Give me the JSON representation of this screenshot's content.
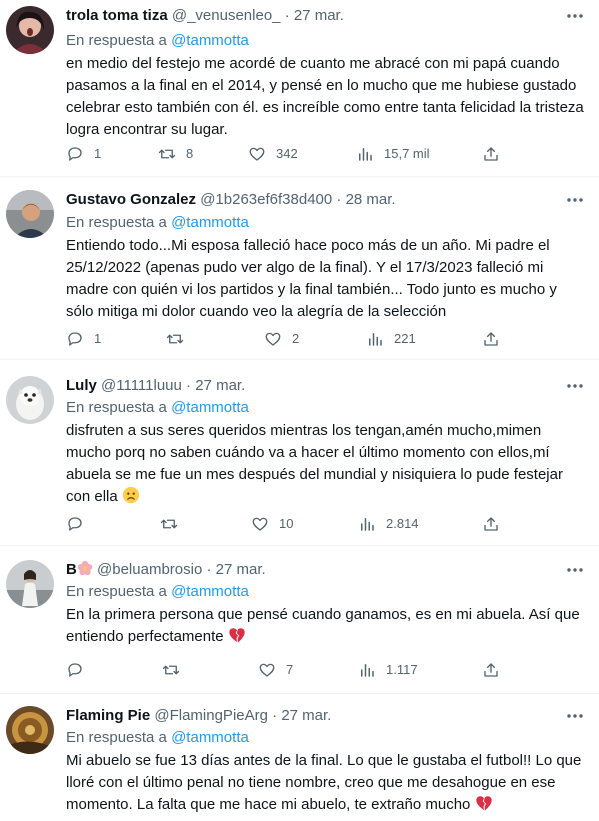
{
  "tweets": [
    {
      "name": "trola toma tiza",
      "handle": "@_venusenleo_",
      "separator": "·",
      "date": "27 mar.",
      "reply_prefix": "En respuesta a",
      "reply_to": "@tammotta",
      "text": "en medio del festejo me acordé de cuanto me abracé con mi papá cuando pasamos a la final en el 2014, y pensé en lo mucho que me hubiese gustado celebrar esto también con él. es increíble como entre tanta felicidad la tristeza logra encontrar su lugar.",
      "replies": "1",
      "retweets": "8",
      "likes": "342",
      "views": "15,7 mil"
    },
    {
      "name": "Gustavo Gonzalez",
      "handle": "@1b263ef6f38d400",
      "separator": "·",
      "date": "28 mar.",
      "reply_prefix": "En respuesta a",
      "reply_to": "@tammotta",
      "text": "Entiendo todo...Mi esposa falleció hace poco más de un año. Mi padre el 25/12/2022 (apenas pudo ver algo de la final). Y el 17/3/2023 falleció mi madre con quién vi los partidos y la final también... Todo junto es mucho y sólo mitiga mi dolor cuando veo la alegría de la selección",
      "replies": "1",
      "retweets": "",
      "likes": "2",
      "views": "221"
    },
    {
      "name": "Luly",
      "handle": "@11111luuu",
      "separator": "·",
      "date": "27 mar.",
      "reply_prefix": "En respuesta a",
      "reply_to": "@tammotta",
      "text": "disfruten a sus seres queridos mientras los tengan,amén mucho,mimen mucho porq no saben cuándo va a hacer el último momento con ellos,mí abuela se me fue un mes después del mundial y nisiquiera lo pude festejar con ella",
      "emoji": "🙁",
      "replies": "",
      "retweets": "",
      "likes": "10",
      "views": "2.814"
    },
    {
      "name": "B",
      "name_emoji": "🌸",
      "handle": "@beluambrosio",
      "separator": "·",
      "date": "27 mar.",
      "reply_prefix": "En respuesta a",
      "reply_to": "@tammotta",
      "text": "En la primera persona que pensé cuando ganamos, es en mi abuela. Así que entiendo perfectamente",
      "emoji": "💔",
      "replies": "",
      "retweets": "",
      "likes": "7",
      "views": "1.117"
    },
    {
      "name": "Flaming Pie",
      "handle": "@FlamingPieArg",
      "separator": "·",
      "date": "27 mar.",
      "reply_prefix": "En respuesta a",
      "reply_to": "@tammotta",
      "text": "Mi abuelo se fue 13 días antes de la final. Lo que le gustaba el futbol!! Lo que lloré con el último penal no tiene nombre, creo que me desahogue en ese momento. La falta que me hace mi abuelo, te extraño mucho",
      "emoji": "💔",
      "replies": "",
      "retweets": "",
      "likes": "",
      "views": ""
    }
  ],
  "more_icon": "more-horizontal-icon",
  "colors": {
    "text": "#0f1419",
    "secondary": "#536471",
    "link": "#1d9bf0",
    "divider": "#eff3f4"
  }
}
